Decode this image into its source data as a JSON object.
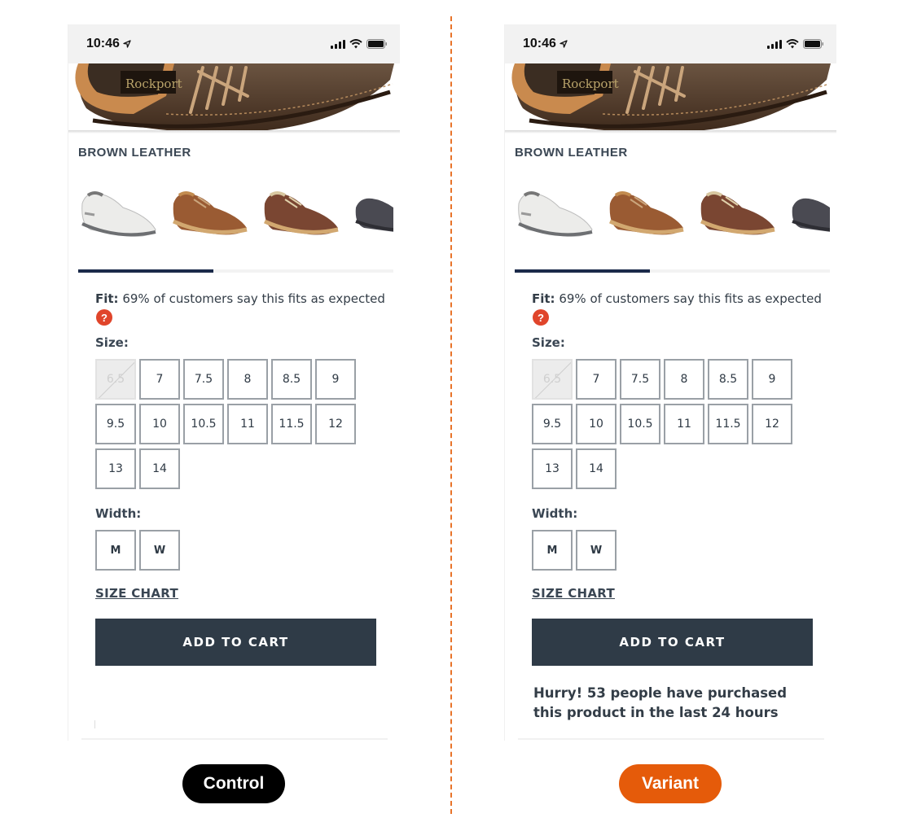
{
  "colors": {
    "divider": "#e8742a",
    "control_badge": "#000000",
    "variant_badge": "#e55b0a",
    "button_bg": "#2f3b47",
    "progress_fill": "#1b2a4a",
    "help_icon": "#e0452b"
  },
  "status_bar": {
    "time": "10:46",
    "location_icon": "location-arrow-icon",
    "icons": [
      "cellular-signal-icon",
      "wifi-icon",
      "battery-icon"
    ]
  },
  "product": {
    "hero_logo_text": "Rockport",
    "color_name": "BROWN LEATHER",
    "thumbnails": [
      {
        "name": "white-shoe-thumbnail",
        "color": "white"
      },
      {
        "name": "tan-shoe-thumbnail",
        "color": "tan"
      },
      {
        "name": "brown-shoe-thumbnail",
        "color": "brown"
      },
      {
        "name": "grey-shoe-thumbnail",
        "color": "grey"
      }
    ],
    "carousel_progress": 0.43,
    "fit": {
      "label": "Fit:",
      "text": "69% of customers say this fits as expected",
      "help_glyph": "?"
    },
    "size_label": "Size:",
    "sizes": [
      {
        "label": "6.5",
        "available": false
      },
      {
        "label": "7",
        "available": true
      },
      {
        "label": "7.5",
        "available": true
      },
      {
        "label": "8",
        "available": true
      },
      {
        "label": "8.5",
        "available": true
      },
      {
        "label": "9",
        "available": true
      },
      {
        "label": "9.5",
        "available": true
      },
      {
        "label": "10",
        "available": true
      },
      {
        "label": "10.5",
        "available": true
      },
      {
        "label": "11",
        "available": true
      },
      {
        "label": "11.5",
        "available": true
      },
      {
        "label": "12",
        "available": true
      },
      {
        "label": "13",
        "available": true
      },
      {
        "label": "14",
        "available": true
      }
    ],
    "width_label": "Width:",
    "widths": [
      "M",
      "W"
    ],
    "size_chart_link": "SIZE CHART",
    "add_to_cart": "ADD TO CART"
  },
  "variant": {
    "urgency_line1": "Hurry! 53 people have purchased",
    "urgency_line2": "this product in the last 24 hours"
  },
  "badges": {
    "control": "Control",
    "variant": "Variant"
  }
}
